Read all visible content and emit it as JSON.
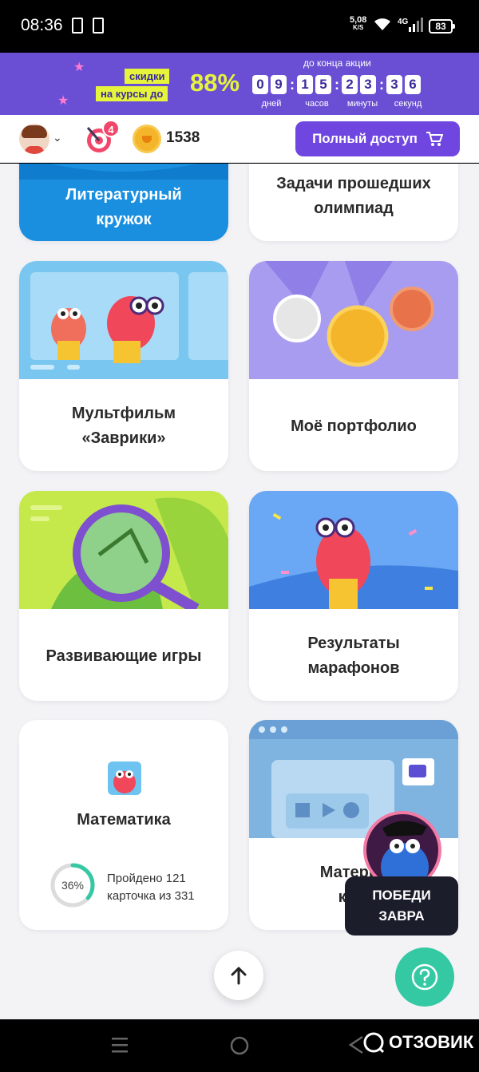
{
  "status_bar": {
    "time": "08:36",
    "net_speed": "5,08",
    "net_speed_unit": "K/S",
    "network": "4G",
    "battery": "83"
  },
  "promo": {
    "tag_line1": "скидки",
    "tag_line2": "на курсы до",
    "percent": "88%",
    "until_label": "до конца акции",
    "timer": {
      "days": [
        "0",
        "9"
      ],
      "hours": [
        "1",
        "5"
      ],
      "minutes": [
        "2",
        "3"
      ],
      "seconds": [
        "3",
        "6"
      ]
    },
    "units": {
      "days": "дней",
      "hours": "часов",
      "minutes": "минуты",
      "seconds": "секунд"
    },
    "colors": {
      "bg": "#6a4fd4",
      "accent": "#e6f53c"
    }
  },
  "header": {
    "badge_count": "4",
    "coins": "1538",
    "full_access_label": "Полный доступ"
  },
  "cards": {
    "lit_club": {
      "line1": "Литературный",
      "line2": "кружок"
    },
    "olympiad": {
      "line1": "Задачи прошедших",
      "line2": "олимпиад"
    },
    "cartoon": {
      "line1": "Мультфильм",
      "line2": "«Заврики»"
    },
    "portfolio": {
      "line1": "Моё портфолио"
    },
    "games": {
      "line1": "Развивающие игры"
    },
    "marathons": {
      "line1": "Результаты",
      "line2": "марафонов"
    },
    "math": {
      "title": "Математика",
      "progress_pct": "36%",
      "progress_line1": "Пройдено 121",
      "progress_line2": "карточка из 331",
      "progress_value": 0.36
    },
    "materials": {
      "line1": "Материа",
      "line2": "к ур"
    }
  },
  "floating": {
    "pobedi_line1": "ПОБЕДИ",
    "pobedi_line2": "ЗАВРА",
    "help_icon": "question-icon",
    "scroll_top_icon": "arrow-up-icon"
  },
  "watermark": "ОТЗОВИК"
}
